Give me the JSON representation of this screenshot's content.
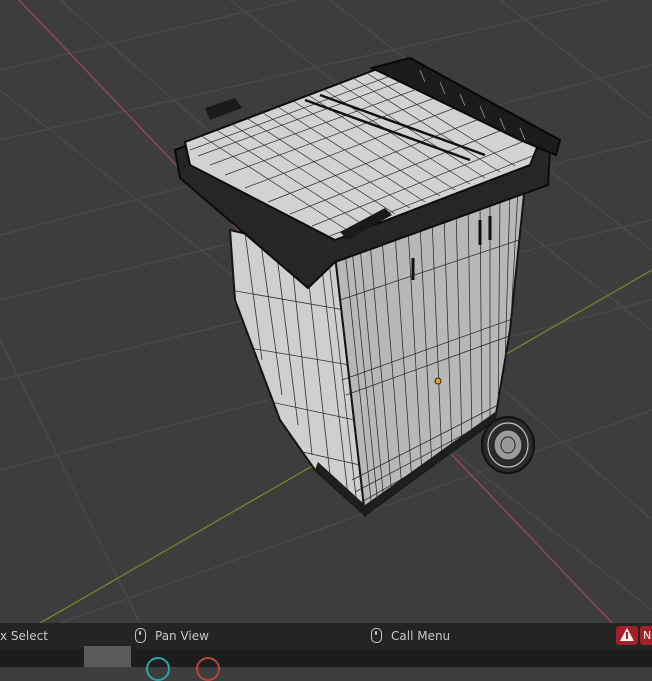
{
  "colors": {
    "viewport_bg": "#3d3d3d",
    "grid": "#4b4b4b",
    "x_axis": "#9a4a4f",
    "y_axis": "#6c8a2c",
    "statusbar_bg": "#242424",
    "warning_red": "#a32027"
  },
  "statusbar": {
    "left_text": "x Select",
    "mid_text": "Pan View",
    "right_text": "Call Menu",
    "warning_icon": "warning-triangle-icon",
    "warning_text": "N"
  },
  "viewport": {
    "object": "wheelie-bin-wireframe",
    "origin_marker_color": "#f0a020"
  }
}
